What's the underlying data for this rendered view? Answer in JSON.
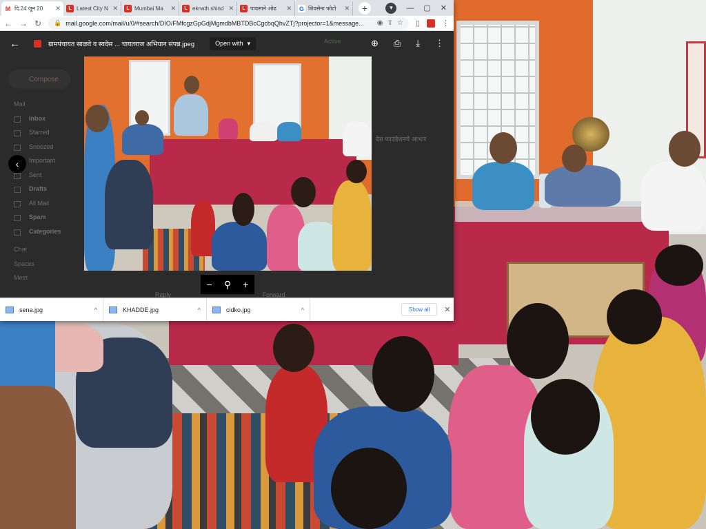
{
  "browser": {
    "tabs": [
      {
        "label": "दि.24 जून 20",
        "favicon": "gmail-icon",
        "active": true
      },
      {
        "label": "Latest City N",
        "favicon": "news-icon",
        "active": false
      },
      {
        "label": "Mumbai Ma",
        "favicon": "news-icon",
        "active": false
      },
      {
        "label": "eknath shind",
        "favicon": "news-icon",
        "active": false
      },
      {
        "label": "पावसाने ओढ",
        "favicon": "news-icon",
        "active": false
      },
      {
        "label": "शिवसेना फोटो",
        "favicon": "google-search-icon",
        "active": false
      }
    ],
    "url": "mail.google.com/mail/u/0/#search/DIO/FMfcgzGpGdjMgmdbMBTDBcCgcbqQhvZTj?projector=1&message..."
  },
  "viewer": {
    "file_title": "ग्रामपंचायत साळवे व स्वदेस ... चायतराज अभियान संपन्न.jpeg",
    "open_with_label": "Open with"
  },
  "gmail_background": {
    "compose_label": "Compose",
    "mail_header": "Mail",
    "nav_items": [
      "Inbox",
      "Starred",
      "Snoozed",
      "Important",
      "Sent",
      "Drafts",
      "All Mail",
      "Spam",
      "Categories"
    ],
    "chat_header": "Chat",
    "spaces_header": "Spaces",
    "meet_header": "Meet",
    "active_status": "Active",
    "snippet": "देस फाउंडेशनचे आभार",
    "reply_label": "Reply",
    "forward_label": "Forward"
  },
  "downloads": {
    "items": [
      "sena.jpg",
      "KHADDE.jpg",
      "cidko.jpg"
    ],
    "show_all_label": "Show all"
  }
}
